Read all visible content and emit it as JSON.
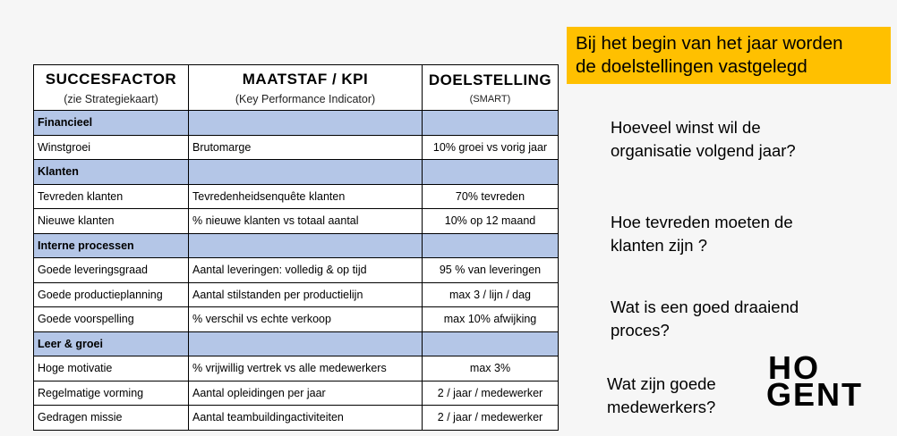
{
  "table": {
    "headers": [
      {
        "title": "SUCCESFACTOR",
        "subtitle": "(zie Strategiekaart)"
      },
      {
        "title": "MAATSTAF / KPI",
        "subtitle": "(Key Performance Indicator)"
      },
      {
        "title": "DOELSTELLING",
        "subtitle": "(SMART)"
      }
    ],
    "rows": [
      {
        "category": true,
        "cells": [
          "Financieel",
          "",
          ""
        ]
      },
      {
        "category": false,
        "cells": [
          "Winstgroei",
          "Brutomarge",
          "10% groei vs vorig jaar"
        ]
      },
      {
        "category": true,
        "cells": [
          "Klanten",
          "",
          ""
        ]
      },
      {
        "category": false,
        "cells": [
          "Tevreden klanten",
          "Tevredenheidsenquête klanten",
          "70% tevreden"
        ]
      },
      {
        "category": false,
        "cells": [
          "Nieuwe klanten",
          "% nieuwe klanten vs totaal aantal",
          "10% op 12 maand"
        ]
      },
      {
        "category": true,
        "cells": [
          "Interne processen",
          "",
          ""
        ]
      },
      {
        "category": false,
        "cells": [
          "Goede leveringsgraad",
          "Aantal leveringen: volledig & op tijd",
          "95 % van leveringen"
        ]
      },
      {
        "category": false,
        "cells": [
          "Goede productieplanning",
          "Aantal stilstanden per productielijn",
          "max 3 / lijn / dag"
        ]
      },
      {
        "category": false,
        "cells": [
          "Goede voorspelling",
          "% verschil vs echte verkoop",
          "max 10% afwijking"
        ]
      },
      {
        "category": true,
        "cells": [
          "Leer & groei",
          "",
          ""
        ]
      },
      {
        "category": false,
        "cells": [
          "Hoge motivatie",
          "% vrijwillig vertrek vs alle medewerkers",
          "max 3%"
        ]
      },
      {
        "category": false,
        "cells": [
          "Regelmatige vorming",
          "Aantal opleidingen per jaar",
          "2 / jaar / medewerker"
        ]
      },
      {
        "category": false,
        "cells": [
          "Gedragen missie",
          "Aantal teambuildingactiviteiten",
          "2 / jaar / medewerker"
        ]
      }
    ]
  },
  "banner": {
    "line1": "Bij het begin van het jaar worden",
    "line2": "de doelstellingen vastgelegd",
    "color": "#ffc000"
  },
  "questions": [
    {
      "line1": "Hoeveel winst wil de",
      "line2": "organisatie volgend jaar?"
    },
    {
      "line1": "Hoe tevreden moeten de",
      "line2": "klanten zijn ?"
    },
    {
      "line1": "Wat is een goed draaiend",
      "line2": "proces?"
    },
    {
      "line1": "Wat zijn goede",
      "line2": "medewerkers?"
    }
  ],
  "logo": {
    "line1": "HO",
    "line2": "GENT"
  },
  "colors": {
    "category_fill": "#b4c6e7",
    "background": "#f6f6f6"
  }
}
